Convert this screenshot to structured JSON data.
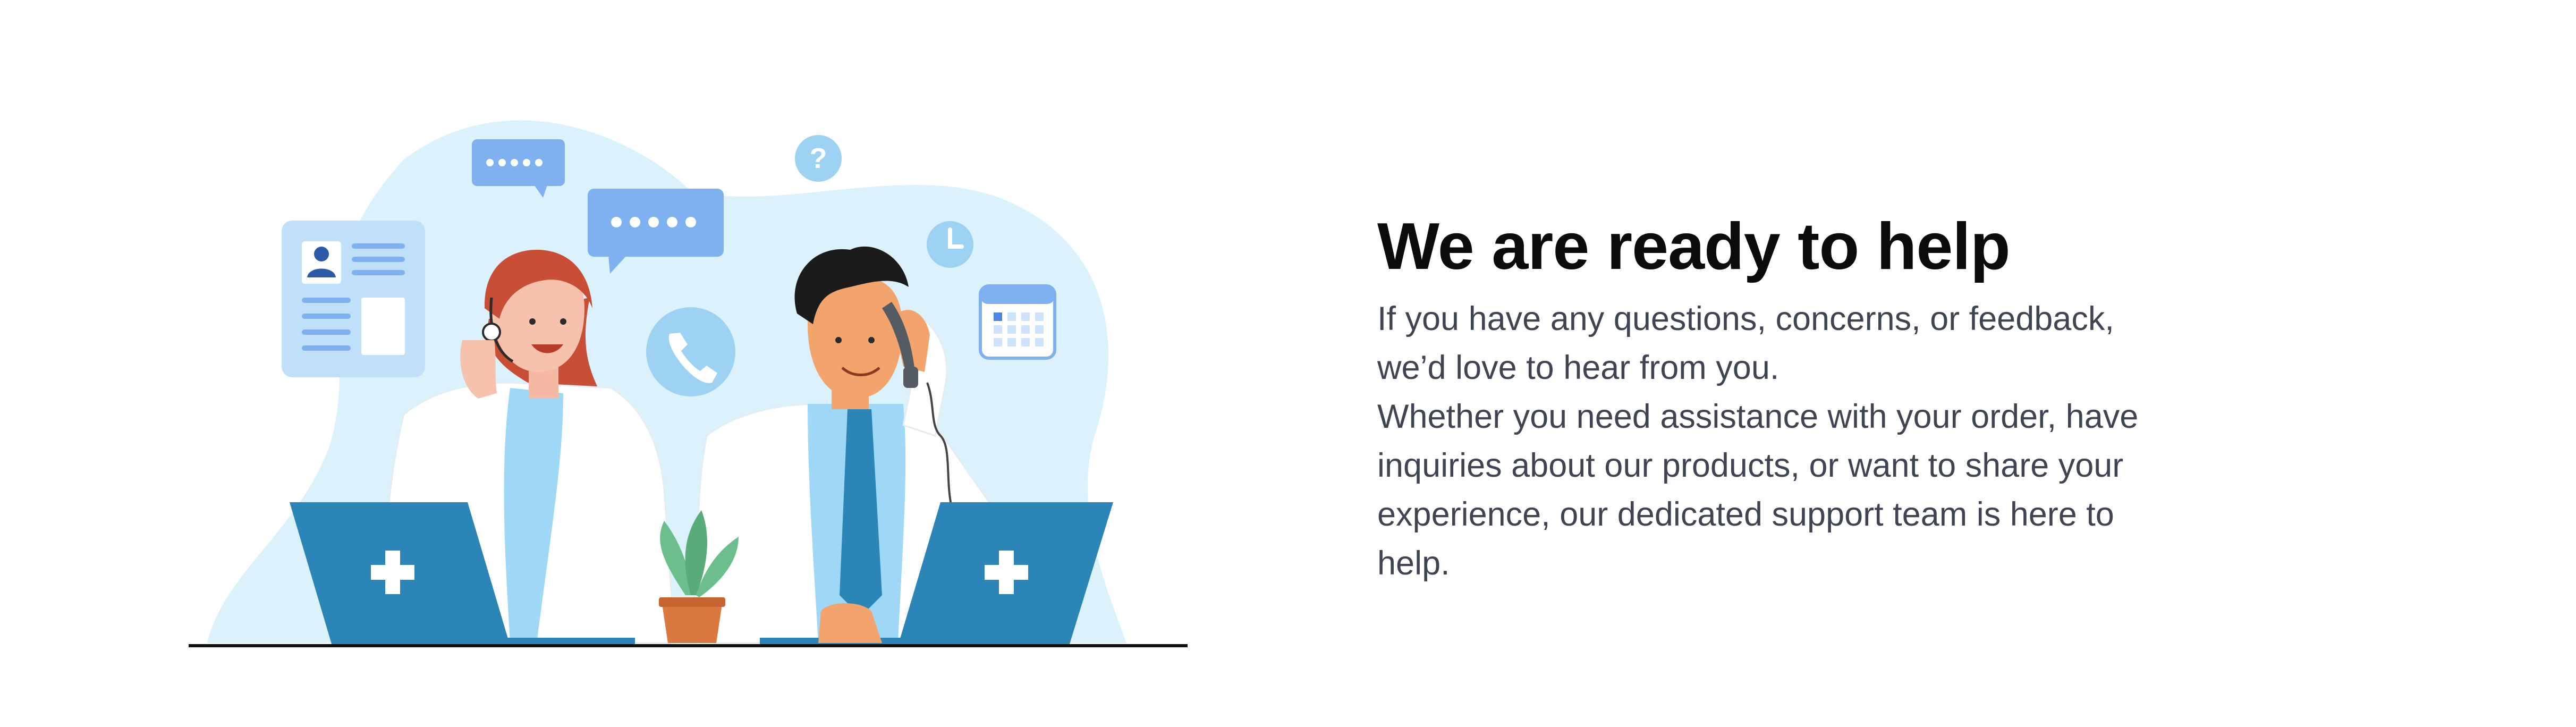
{
  "hero": {
    "heading": "We are ready to help",
    "paragraph_1": "If you have any questions, concerns, or feedback, we’d love to hear from you.",
    "paragraph_2": "Whether you need assistance with your order, have inquiries about our products, or want to share your experience, our dedicated support team is here to help."
  },
  "illustration": {
    "question_bubble_text": "?",
    "icons": [
      "contact-card-icon",
      "chat-bubble-icon",
      "question-icon",
      "clock-icon",
      "calendar-icon",
      "phone-icon",
      "medical-cross-icon",
      "plant-icon"
    ]
  },
  "colors": {
    "accent_blue": "#2b86b7",
    "light_blue": "#dbf1fb",
    "bubble_blue": "#7fb0f0",
    "heading": "#0b0b0b",
    "body_text": "#3e4452"
  }
}
